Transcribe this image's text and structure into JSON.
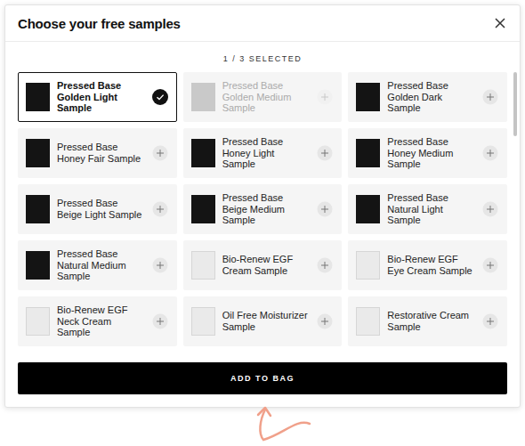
{
  "modal": {
    "title": "Choose your free samples",
    "selection_count": "1 / 3 SELECTED"
  },
  "samples": [
    {
      "name": "Pressed Base Golden Light Sample",
      "kind": "foundation",
      "selected": true,
      "disabled": false
    },
    {
      "name": "Pressed Base Golden Medium Sample",
      "kind": "foundation",
      "selected": false,
      "disabled": true
    },
    {
      "name": "Pressed Base Golden Dark Sample",
      "kind": "foundation",
      "selected": false,
      "disabled": false
    },
    {
      "name": "Pressed Base Honey Fair Sample",
      "kind": "foundation",
      "selected": false,
      "disabled": false
    },
    {
      "name": "Pressed Base Honey Light Sample",
      "kind": "foundation",
      "selected": false,
      "disabled": false
    },
    {
      "name": "Pressed Base Honey Medium Sample",
      "kind": "foundation",
      "selected": false,
      "disabled": false
    },
    {
      "name": "Pressed Base Beige Light Sample",
      "kind": "foundation",
      "selected": false,
      "disabled": false
    },
    {
      "name": "Pressed Base Beige Medium Sample",
      "kind": "foundation",
      "selected": false,
      "disabled": false
    },
    {
      "name": "Pressed Base Natural Light Sample",
      "kind": "foundation",
      "selected": false,
      "disabled": false
    },
    {
      "name": "Pressed Base Natural Medium Sample",
      "kind": "foundation",
      "selected": false,
      "disabled": false
    },
    {
      "name": "Bio-Renew EGF Cream Sample",
      "kind": "skincare",
      "selected": false,
      "disabled": false
    },
    {
      "name": "Bio-Renew EGF Eye Cream Sample",
      "kind": "skincare",
      "selected": false,
      "disabled": false
    },
    {
      "name": "Bio-Renew EGF Neck Cream Sample",
      "kind": "skincare",
      "selected": false,
      "disabled": false
    },
    {
      "name": "Oil Free Moisturizer Sample",
      "kind": "skincare",
      "selected": false,
      "disabled": false
    },
    {
      "name": "Restorative Cream Sample",
      "kind": "skincare",
      "selected": false,
      "disabled": false
    }
  ],
  "add_button": "ADD TO BAG"
}
